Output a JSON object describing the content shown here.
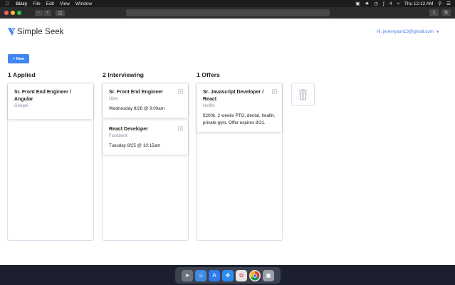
{
  "menubar": {
    "app_name": "Sizzy",
    "menus": [
      "File",
      "Edit",
      "View",
      "Window"
    ],
    "battery": "4",
    "clock": "Thu 12:12 AM"
  },
  "app": {
    "brand": "Simple Seek",
    "user_label": "Hi, jeremyash13@gmail.com",
    "new_button": "+ New"
  },
  "columns": [
    {
      "title": "1 Applied",
      "cards": [
        {
          "title": "Sr. Front End Engineer / Angular",
          "company": "Google",
          "detail": "",
          "editable": false
        }
      ]
    },
    {
      "title": "2 Interviewing",
      "cards": [
        {
          "title": "Sr. Front End Engineer",
          "company": "Uber",
          "detail": "Wednesday 8/26 @ 9:00am",
          "editable": true
        },
        {
          "title": "React Developer",
          "company": "Facebook",
          "detail": "Tuesday 8/25 @ 10:15am",
          "editable": true
        }
      ]
    },
    {
      "title": "1 Offers",
      "cards": [
        {
          "title": "Sr. Javascript Developer / React",
          "company": "Netflix",
          "detail": "$200k, 2 weeks PTO, dental, health, private gym. Offer expires 8/31.",
          "editable": true
        }
      ]
    }
  ],
  "colors": {
    "accent": "#3f86f2",
    "link": "#4a7ae0",
    "border": "#d9e0ee"
  },
  "dock_icons": [
    "launchpad-icon",
    "finder-icon",
    "app-store-icon",
    "safari-icon",
    "photos-icon",
    "chrome-icon",
    "preview-icon"
  ]
}
